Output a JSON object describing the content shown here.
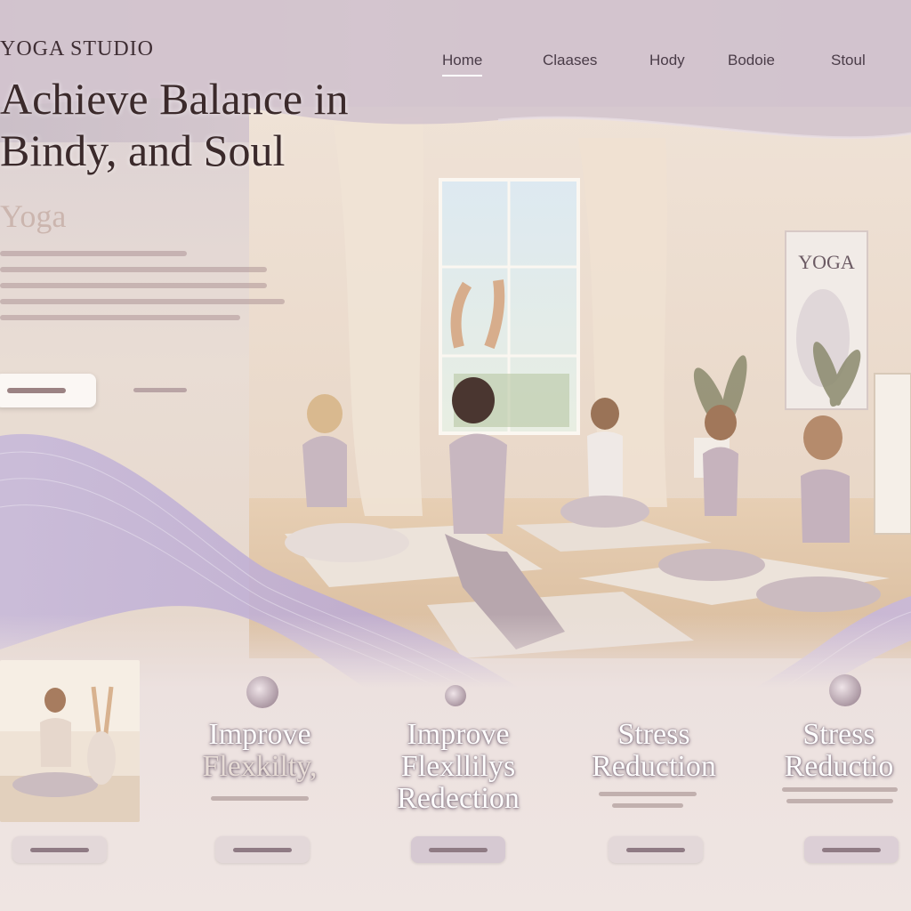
{
  "header": {
    "brand": "YOGA STUDIO",
    "nav": [
      {
        "label": "Home",
        "active": true
      },
      {
        "label": "Claases",
        "active": false
      },
      {
        "label": "Hody",
        "active": false
      },
      {
        "label": "Bodoie",
        "active": false
      },
      {
        "label": "Stoul",
        "active": false
      }
    ]
  },
  "hero": {
    "title_line1": "Achieve Balance in",
    "title_line2": "Bindy, and Soul",
    "subtitle": "Yoga"
  },
  "scene": {
    "poster_text": "YOGA"
  },
  "features": [
    {
      "title_lines": [
        "Improve",
        "Flexkilty,"
      ]
    },
    {
      "title_lines": [
        "Improve",
        "Flexllilys",
        "Redection"
      ]
    },
    {
      "title_lines": [
        "Stress",
        "Reduction"
      ]
    },
    {
      "title_lines": [
        "Stress",
        "Reductio"
      ]
    }
  ],
  "colors": {
    "accent": "#b9a7c9",
    "wave": "#c2b3d6",
    "text_dark": "#3b2a2b"
  }
}
